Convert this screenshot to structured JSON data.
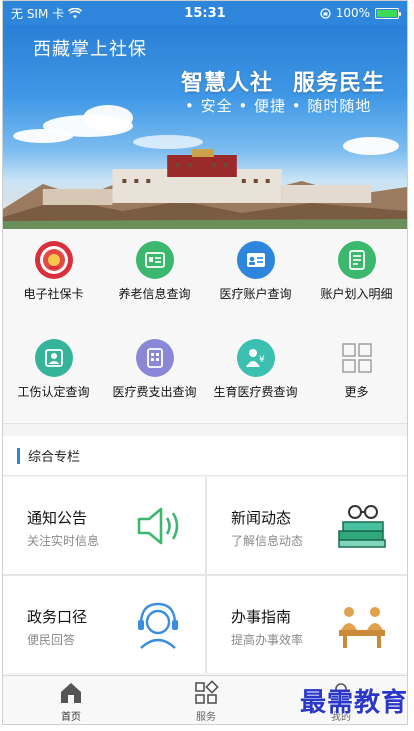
{
  "status_bar": {
    "carrier": "无 SIM 卡",
    "time": "15:31",
    "battery": "100%",
    "battery_level": 1.0
  },
  "banner": {
    "app_title": "西藏掌上社保",
    "slogan_left": "智慧人社",
    "slogan_right": "服务民生",
    "subslogan": "• 安全 • 便捷 • 随时随地"
  },
  "services": [
    {
      "label": "电子社保卡",
      "icon": "social-card-icon",
      "color": "#d8303c"
    },
    {
      "label": "养老信息查询",
      "icon": "pension-icon",
      "color": "#3cb86e"
    },
    {
      "label": "医疗账户查询",
      "icon": "medical-account-icon",
      "color": "#2d86dc"
    },
    {
      "label": "账户划入明细",
      "icon": "account-detail-icon",
      "color": "#3cb86e"
    },
    {
      "label": "工伤认定查询",
      "icon": "injury-icon",
      "color": "#35b49a"
    },
    {
      "label": "医疗费支出查询",
      "icon": "medical-expense-icon",
      "color": "#8a88d6"
    },
    {
      "label": "生育医疗费查询",
      "icon": "maternity-icon",
      "color": "#3bbfb0"
    },
    {
      "label": "更多",
      "icon": "grid-more-icon",
      "color": "#9a9a9a"
    }
  ],
  "section": {
    "title": "综合专栏",
    "accent": "#2d86dc"
  },
  "cards": [
    {
      "title": "通知公告",
      "subtitle": "关注实时信息",
      "icon": "speaker-icon"
    },
    {
      "title": "新闻动态",
      "subtitle": "了解信息动态",
      "icon": "books-icon"
    },
    {
      "title": "政务口径",
      "subtitle": "便民回答",
      "icon": "headset-icon"
    },
    {
      "title": "办事指南",
      "subtitle": "提高办事效率",
      "icon": "service-desk-icon"
    }
  ],
  "tabbar": [
    {
      "label": "首页",
      "icon": "home-icon",
      "active": true
    },
    {
      "label": "服务",
      "icon": "services-icon",
      "active": false
    },
    {
      "label": "我的",
      "icon": "profile-icon",
      "active": false
    }
  ],
  "watermark": "最需教育"
}
